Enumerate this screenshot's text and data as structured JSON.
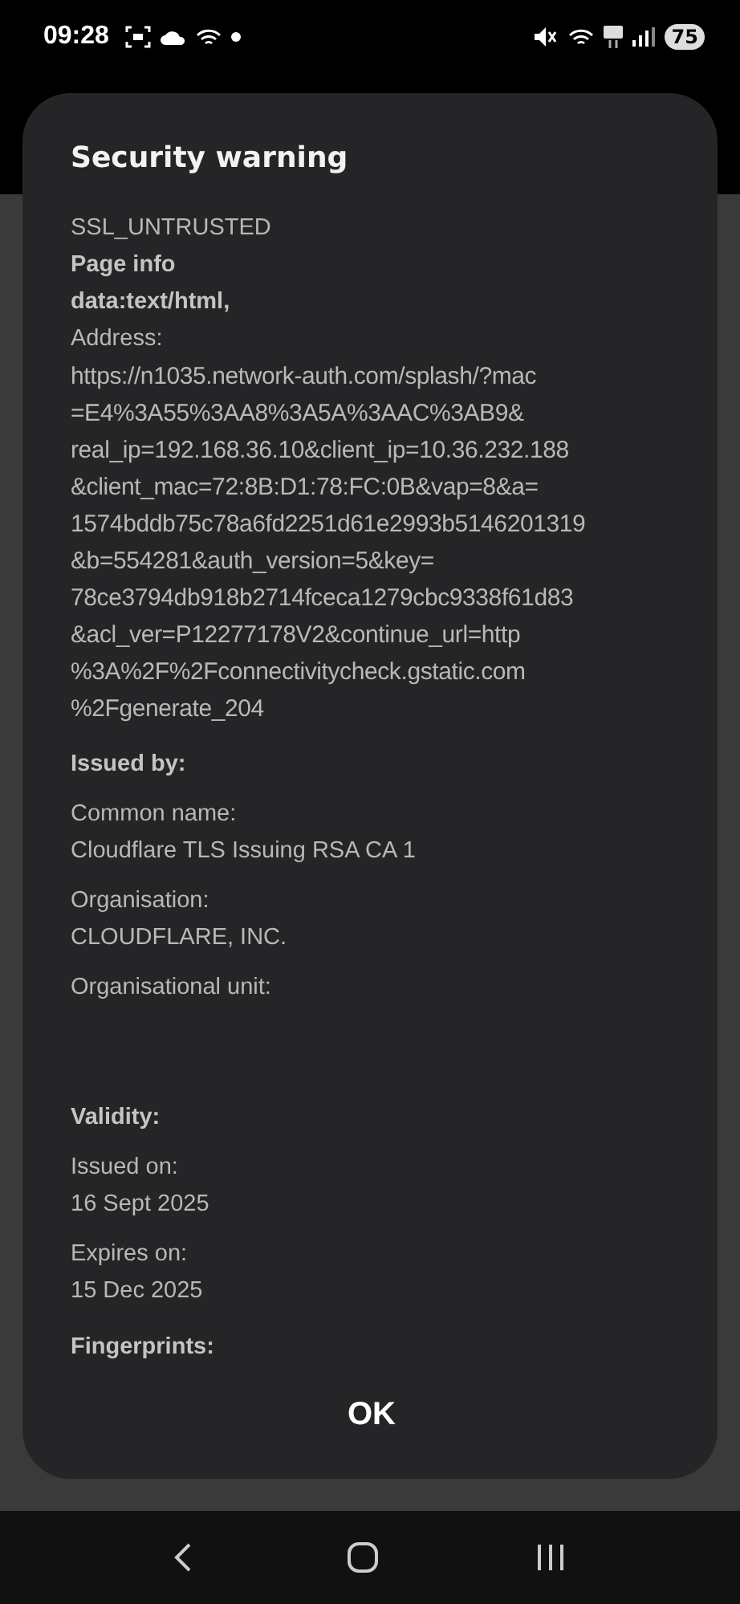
{
  "status_bar": {
    "time": "09:28",
    "battery": "75"
  },
  "dialog": {
    "title": "Security warning",
    "lines": [
      {
        "kind": "text",
        "text": "SSL_UNTRUSTED"
      },
      {
        "kind": "heading",
        "text": "Page info"
      },
      {
        "kind": "heading",
        "text": "data:text/html,"
      },
      {
        "kind": "text",
        "text": "Address:"
      },
      {
        "kind": "url",
        "lines": [
          "https://n1035.network-auth.com/splash/?mac",
          "=E4%3A55%3AA8%3A5A%3AAC%3AB9&",
          "real_ip=192.168.36.10&client_ip=10.36.232.188",
          "&client_mac=72:8B:D1:78:FC:0B&vap=8&a=",
          "1574bddb75c78a6fd2251d61e2993b5146201319",
          "&b=554281&auth_version=5&key=",
          "78ce3794db918b2714fceca1279cbc9338f61d83",
          "&acl_ver=P12277178V2&continue_url=http",
          "%3A%2F%2Fconnectivitycheck.gstatic.com",
          "%2Fgenerate_204"
        ]
      },
      {
        "kind": "section",
        "text": "Issued by:"
      },
      {
        "kind": "field",
        "label": "Common name:",
        "value": "Cloudflare TLS Issuing RSA CA 1"
      },
      {
        "kind": "field",
        "label": "Organisation:",
        "value": "CLOUDFLARE, INC."
      },
      {
        "kind": "field",
        "label": "Organisational unit:"
      },
      {
        "kind": "section",
        "text": "Validity:"
      },
      {
        "kind": "field",
        "label": "Issued on:",
        "value": "16 Sept 2025"
      },
      {
        "kind": "field",
        "label": "Expires on:",
        "value": "15 Dec 2025"
      },
      {
        "kind": "section",
        "text": "Fingerprints:"
      }
    ],
    "button": "OK"
  }
}
